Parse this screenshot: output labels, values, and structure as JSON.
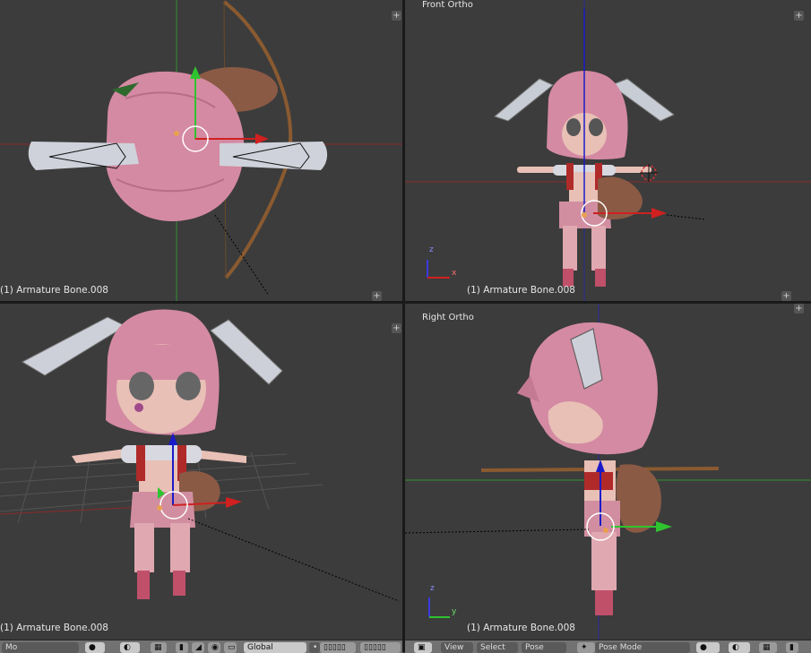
{
  "viewports": {
    "top_left": {
      "label": "",
      "status": "(1) Armature Bone.008"
    },
    "top_right": {
      "label": "Front Ortho",
      "status": "(1) Armature Bone.008"
    },
    "bottom_left": {
      "label": "",
      "status": "(1) Armature Bone.008"
    },
    "bottom_right": {
      "label": "Right Ortho",
      "status": "(1) Armature Bone.008"
    }
  },
  "axis_labels": {
    "z": "z",
    "x": "x",
    "y": "y"
  },
  "header_left": {
    "mode_label": "Mo",
    "pivot_label": "Global"
  },
  "header_right": {
    "view_label": "View",
    "select_label": "Select",
    "pose_label": "Pose",
    "mode_label": "Pose Mode"
  },
  "corner_glyph": "+",
  "colors": {
    "bg": "#3c3c3c",
    "hair": "#d98fa6",
    "skin": "#e8c0b6",
    "bone_white": "#c8ccd4",
    "x_axis": "#b02525",
    "y_axis": "#3cbf3c",
    "z_axis": "#2a2ad0"
  }
}
